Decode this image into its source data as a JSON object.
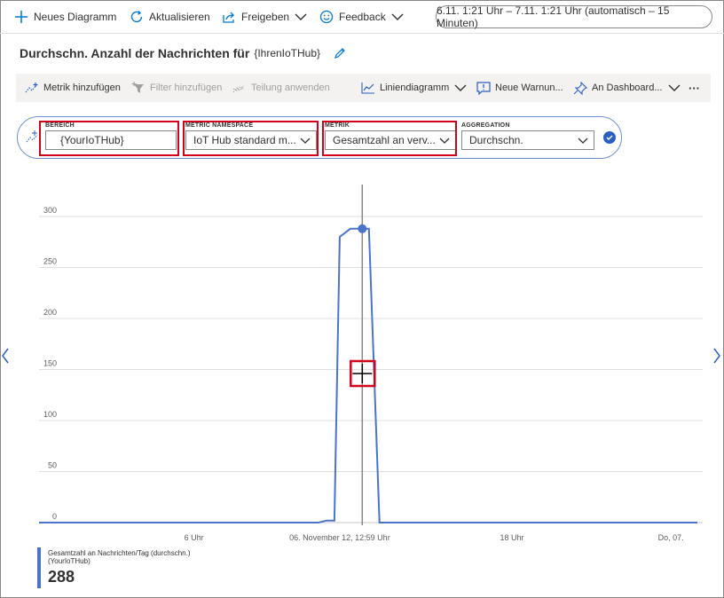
{
  "commandbar": {
    "new_chart": "Neues Diagramm",
    "refresh": "Aktualisieren",
    "share": "Freigeben",
    "feedback": "Feedback",
    "time_range": "6.11. 1:21 Uhr – 7.11. 1:21 Uhr (automatisch – 15 Minuten)"
  },
  "header": {
    "title": "Durchschn. Anzahl der Nachrichten für",
    "subtitle": "{IhrenIoTHub}"
  },
  "toolbar": {
    "add_metric": "Metrik hinzufügen",
    "add_filter": "Filter hinzufügen",
    "apply_split": "Teilung anwenden",
    "line_chart": "Liniendiagramm",
    "new_alert": "Neue Warnun...",
    "to_dashboard": "An Dashboard...",
    "more": "···"
  },
  "selector": {
    "scope_label": "BEREICH",
    "scope_value": "{YourIoTHub}",
    "namespace_label": "METRIC NAMESPACE",
    "namespace_value": "IoT Hub standard m...",
    "metric_label": "METRIK",
    "metric_value": "Gesamtzahl an verv...",
    "aggregation_label": "AGGREGATION",
    "aggregation_value": "Durchschn."
  },
  "icons": {
    "colors": {
      "accent": "#0078d4",
      "series": "#4a74c9",
      "highlight": "#d0021b"
    }
  },
  "chart_data": {
    "type": "line",
    "yticks": [
      "300",
      "250",
      "200",
      "150",
      "100",
      "50",
      "0"
    ],
    "ylim": [
      0,
      300
    ],
    "xticks": [
      {
        "label": "6 Uhr",
        "x": 6
      },
      {
        "label": "06. November 12, 12:59 Uhr",
        "x": 11.5
      },
      {
        "label": "18 Uhr",
        "x": 18
      },
      {
        "label": "Do, 07.",
        "x": 24
      }
    ],
    "xlim": [
      0.15,
      25.2
    ],
    "grid": true,
    "series": [
      {
        "name": "Gesamtzahl an Nachrichten/Tag (durchschn.)",
        "points": [
          [
            0.15,
            0
          ],
          [
            10.7,
            0
          ],
          [
            11.0,
            2
          ],
          [
            11.3,
            2
          ],
          [
            11.5,
            280
          ],
          [
            11.9,
            288
          ],
          [
            12.6,
            288
          ],
          [
            13.0,
            0
          ],
          [
            25.0,
            0
          ]
        ]
      }
    ],
    "cursor_x": 12.35,
    "marker": {
      "x": 12.35,
      "y": 288
    }
  },
  "legend": {
    "series_name": "Gesamtzahl an Nachrichten/Tag (durchschn.)",
    "resource": "(YourIoTHub)",
    "value": "288"
  }
}
